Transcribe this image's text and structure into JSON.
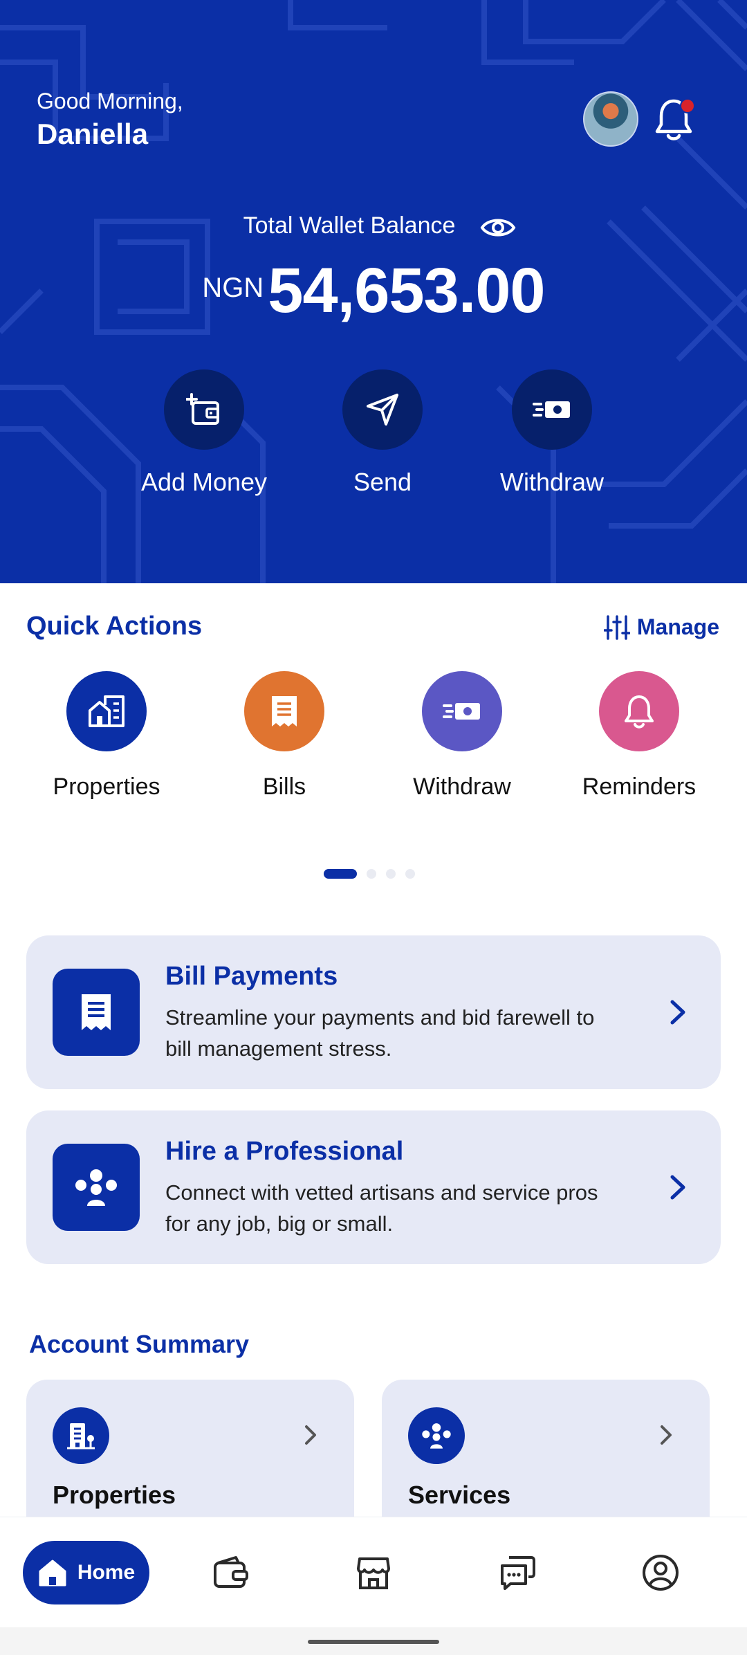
{
  "header": {
    "greeting": "Good Morning,",
    "user_name": "Daniella",
    "balance_label": "Total Wallet Balance",
    "currency": "NGN",
    "balance": "54,653.00",
    "actions": [
      {
        "label": "Add Money",
        "icon": "add-wallet-icon"
      },
      {
        "label": "Send",
        "icon": "send-icon"
      },
      {
        "label": "Withdraw",
        "icon": "cash-icon"
      }
    ],
    "notification_dot_color": "#d8232a",
    "background_color": "#0b2fa6"
  },
  "quick_actions": {
    "title": "Quick Actions",
    "manage_label": "Manage",
    "items": [
      {
        "label": "Properties",
        "icon": "buildings-icon",
        "color": "#0b2fa6"
      },
      {
        "label": "Bills",
        "icon": "receipt-icon",
        "color": "#e07430"
      },
      {
        "label": "Withdraw",
        "icon": "cash-icon",
        "color": "#5b57c4"
      },
      {
        "label": "Reminders",
        "icon": "bell-icon",
        "color": "#d9588f"
      }
    ],
    "page_count": 4,
    "active_page": 1
  },
  "promos": [
    {
      "title": "Bill Payments",
      "description_line1": "Streamline your payments and bid farewell to",
      "description_line2": "bill management stress.",
      "icon": "receipt-icon"
    },
    {
      "title": "Hire a Professional",
      "description_line1": "Connect with vetted artisans and service pros",
      "description_line2": "for any job, big or small.",
      "icon": "people-icon"
    }
  ],
  "account_summary": {
    "title": "Account Summary",
    "cards": [
      {
        "label": "Properties",
        "icon": "building-icon"
      },
      {
        "label": "Services",
        "icon": "people-icon"
      }
    ]
  },
  "bottom_nav": {
    "items": [
      {
        "label": "Home",
        "icon": "home-icon",
        "active": true
      },
      {
        "label": "",
        "icon": "wallet-icon",
        "active": false
      },
      {
        "label": "",
        "icon": "store-icon",
        "active": false
      },
      {
        "label": "",
        "icon": "chat-icon",
        "active": false
      },
      {
        "label": "",
        "icon": "profile-icon",
        "active": false
      }
    ]
  },
  "colors": {
    "primary": "#0b2fa6",
    "card_bg": "#e6e9f6"
  }
}
